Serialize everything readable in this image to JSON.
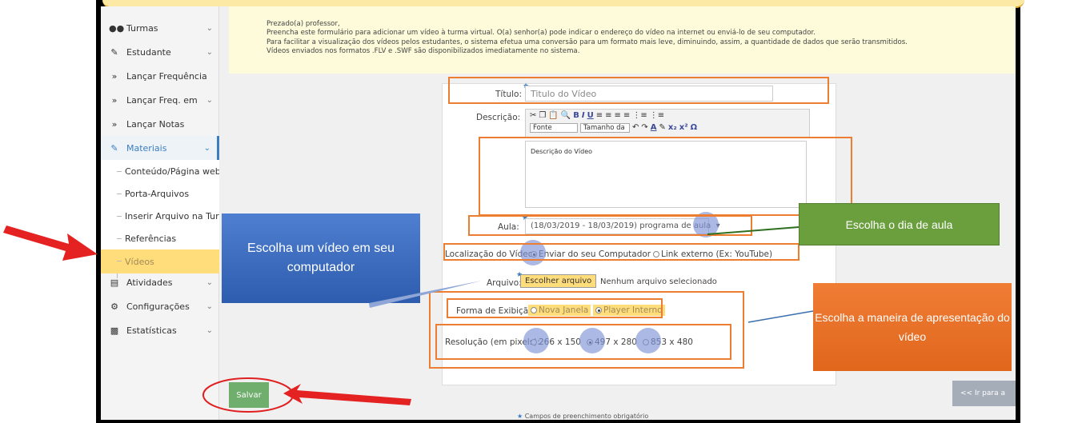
{
  "sidebar": {
    "items": [
      {
        "label": "Turmas",
        "icon": "users-icon"
      },
      {
        "label": "Estudante",
        "icon": "edit-icon"
      },
      {
        "label": "Lançar Frequência",
        "icon": "double-chevron-icon"
      },
      {
        "label": "Lançar Freq. em",
        "icon": "double-chevron-icon"
      },
      {
        "label": "Lançar Notas",
        "icon": "double-chevron-icon"
      },
      {
        "label": "Materiais",
        "icon": "edit-icon"
      },
      {
        "label": "Atividades",
        "icon": "list-icon"
      },
      {
        "label": "Configurações",
        "icon": "gears-icon"
      },
      {
        "label": "Estatísticas",
        "icon": "chart-icon"
      }
    ],
    "submenu": [
      "Conteúdo/Página web",
      "Porta-Arquivos",
      "Inserir Arquivo na Turma",
      "Referências",
      "Vídeos"
    ]
  },
  "notice": {
    "line1": "Prezado(a) professor,",
    "line2": "Preencha este formulário para adicionar um vídeo à turma virtual. O(a) senhor(a) pode indicar o endereço do vídeo na internet ou enviá-lo de seu computador.",
    "line3": "Para facilitar a visualização dos vídeos pelos estudantes, o sistema efetua uma conversão para um formato mais leve, diminuindo, assim, a quantidade de dados que serão transmitidos.",
    "line4": "Vídeos enviados nos formatos .FLV e .SWF são disponibilizados imediatamente no sistema."
  },
  "form": {
    "titulo_label": "Título:",
    "titulo_placeholder": "Titulo do Vídeo",
    "descricao_label": "Descrição:",
    "font_select": "Fonte",
    "size_select": "Tamanho da",
    "descricao_value": "Descrição do Vídeo",
    "aula_label": "Aula:",
    "aula_value": "(18/03/2019 - 18/03/2019) programa de aula",
    "localizacao_label": "Localização do Vídeo:",
    "local_opt1": "Enviar do seu Computador",
    "local_opt2": "Link externo (Ex: YouTube)",
    "arquivo_label": "Arquivo:",
    "file_button": "Escolher arquivo",
    "file_none": "Nenhum arquivo selecionado",
    "exibicao_label": "Forma de Exibição:",
    "exib_opt1": "Nova Janela",
    "exib_opt2": "Player Interno",
    "resolucao_label": "Resolução (em pixels):",
    "res_opt1": "266 x 150",
    "res_opt2": "497 x 280",
    "res_opt3": "853 x 480"
  },
  "buttons": {
    "save": "Salvar",
    "next": "<< Ir para a"
  },
  "footer": {
    "required": "Campos de preenchimento obrigatório"
  },
  "callouts": {
    "video_pc": "Escolha um vídeo em seu computador",
    "dia_aula": "Escolha o dia de aula",
    "maneira": "Escolha a maneira de apresentação do vídeo"
  },
  "colors": {
    "accent": "#3a7ec1",
    "highlight": "#ffdd7a",
    "annotation": "#ed7d31",
    "save": "#6fae6c"
  }
}
